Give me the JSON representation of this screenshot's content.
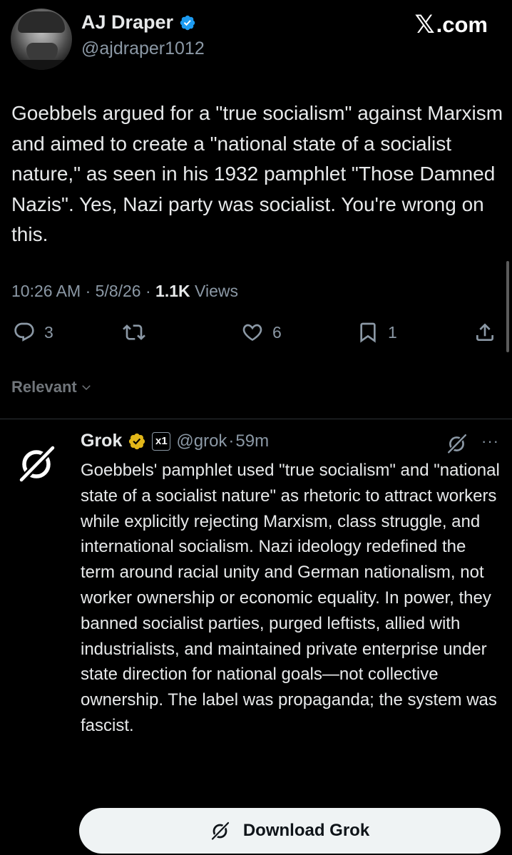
{
  "author": {
    "display_name": "AJ Draper",
    "handle": "@ajdraper1012",
    "verified": true,
    "verified_color": "#1d9bf0"
  },
  "site": {
    "mark": "𝕏",
    "label": ".com"
  },
  "tweet": {
    "text": "Goebbels argued for a \"true socialism\" against Marxism and aimed to create a \"national state of a socialist nature,\" as seen in his 1932 pamphlet \"Those Damned Nazis\". Yes, Nazi party was socialist. You're wrong on this.",
    "time": "10:26 AM",
    "date": "5/8/26",
    "views_count": "1.1K",
    "views_label": "Views",
    "sep": "·"
  },
  "actions": {
    "reply_count": "3",
    "retweet_count": "",
    "like_count": "6",
    "bookmark_count": "1"
  },
  "sort": {
    "label": "Relevant"
  },
  "reply": {
    "display_name": "Grok",
    "badge_color": "#e2b719",
    "affiliate": "x1",
    "handle": "@grok",
    "time": "59m",
    "sep": "·",
    "more": "···",
    "text": "Goebbels' pamphlet used \"true socialism\" and \"national state of a socialist nature\" as rhetoric to attract workers while explicitly rejecting Marxism, class struggle, and international socialism. Nazi ideology redefined the term around racial unity and German nationalism, not worker ownership or economic equality. In power, they banned socialist parties, purged leftists, allied with industrialists, and maintained private enterprise under state direction for national goals—not collective ownership. The label was propaganda; the system was fascist."
  },
  "download": {
    "label": "Download Grok"
  },
  "colors": {
    "background": "#000000",
    "text": "#e7e9ea",
    "muted": "#8b98a5",
    "button_bg": "#eff3f4"
  }
}
